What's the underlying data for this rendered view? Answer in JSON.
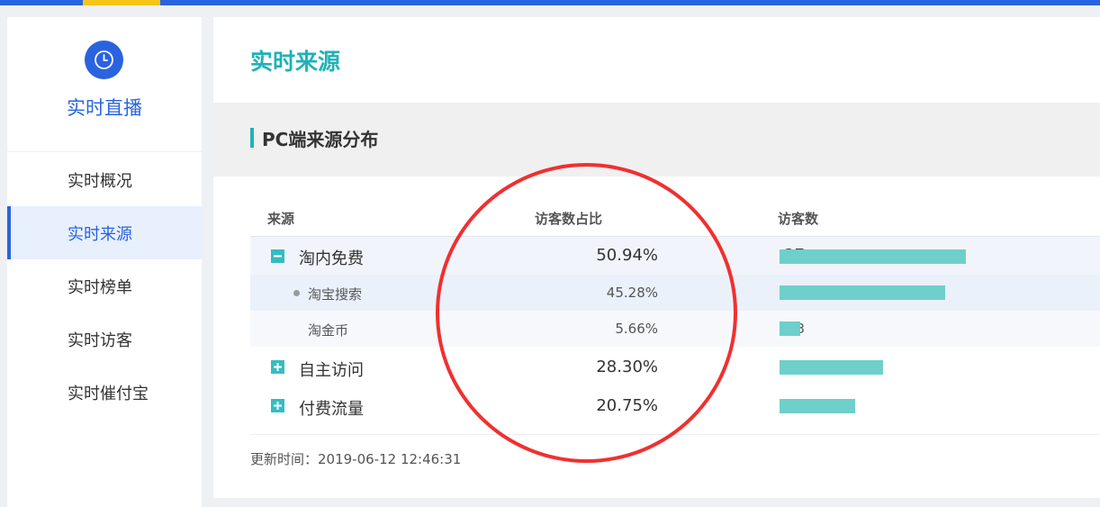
{
  "sidebar": {
    "title": "实时直播",
    "icon": "clock-icon",
    "items": [
      {
        "label": "实时概况",
        "active": false
      },
      {
        "label": "实时来源",
        "active": true
      },
      {
        "label": "实时榜单",
        "active": false
      },
      {
        "label": "实时访客",
        "active": false
      },
      {
        "label": "实时催付宝",
        "active": false
      }
    ]
  },
  "header": {
    "page_title": "实时来源"
  },
  "section": {
    "title": "PC端来源分布"
  },
  "table": {
    "columns": [
      "来源",
      "访客数占比",
      "访客数"
    ],
    "rows": [
      {
        "label": "淘内免费",
        "percent": "50.94%",
        "count": "27",
        "count_value": 27,
        "level": 0,
        "toggle": "minus-icon"
      },
      {
        "label": "淘宝搜索",
        "percent": "45.28%",
        "count": "24",
        "count_value": 24,
        "level": 1,
        "bullet": true
      },
      {
        "label": "淘金币",
        "percent": "5.66%",
        "count": "3",
        "count_value": 3,
        "level": 1,
        "bullet": false
      },
      {
        "label": "自主访问",
        "percent": "28.30%",
        "count": "15",
        "count_value": 15,
        "level": 0,
        "toggle": "plus-icon"
      },
      {
        "label": "付费流量",
        "percent": "20.75%",
        "count": "11",
        "count_value": 11,
        "level": 0,
        "toggle": "plus-icon"
      }
    ]
  },
  "footer": {
    "update_time": "更新时间：2019-06-12 12:46:31"
  },
  "colors": {
    "primary": "#2a63e0",
    "accent": "#1fb2b8",
    "bar": "#6ecfcb",
    "annotation": "#f03030"
  }
}
